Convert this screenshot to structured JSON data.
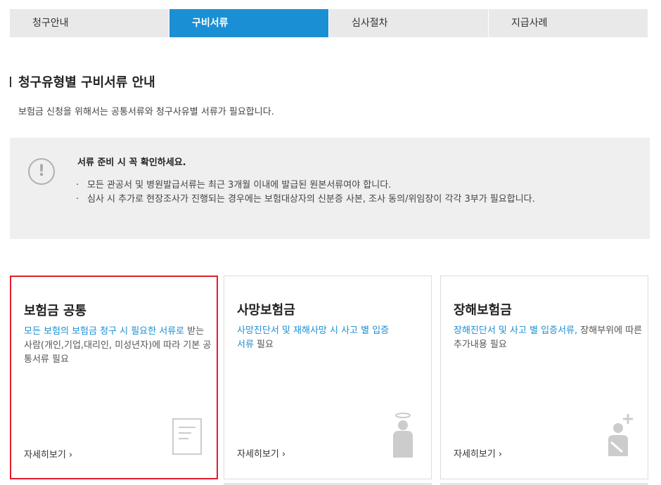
{
  "tabs": [
    "청구안내",
    "구비서류",
    "심사절차",
    "지급사례"
  ],
  "active_tab_index": 1,
  "section": {
    "title": "청구유형별 구비서류 안내",
    "subtitle": "보험금 신청을 위해서는 공통서류와 청구사유별 서류가 필요합니다."
  },
  "notice": {
    "icon": "exclamation-icon",
    "title": "서류 준비 시 꼭 확인하세요.",
    "items": [
      "모든 관공서 및 병원발급서류는 최근 3개월 이내에 발급된 원본서류여야 합니다.",
      "심사 시 추가로 현장조사가 진행되는 경우에는 보험대상자의 신분증 사본, 조사 동의/위임장이 각각 3부가 필요합니다."
    ]
  },
  "cards": [
    {
      "title": "보험금 공통",
      "desc_highlight": "모든 보험의 보험금 청구 시 필요한 서류로",
      "desc_rest": " 받는 사람(개인,기업,대리인, 미성년자)에 따라 기본 공통서류 필요",
      "more": "자세히보기 ›",
      "icon": "document-icon"
    },
    {
      "title": "사망보험금",
      "desc_highlight": "사망진단서 및 재해사망 시 사고 별 입증서류",
      "desc_rest": " 필요",
      "more": "자세히보기 ›",
      "icon": "angel-person-icon"
    },
    {
      "title": "장해보험금",
      "desc_highlight": "장해진단서 및 사고 별 입증서류,",
      "desc_rest": " 장해부위에 따른 추가내용 필요",
      "more": "자세히보기 ›",
      "icon": "injured-person-icon"
    }
  ],
  "colors": {
    "accent": "#1a8fd4",
    "selected_border": "#e11d2a",
    "tab_bg": "#e9e9e9"
  }
}
